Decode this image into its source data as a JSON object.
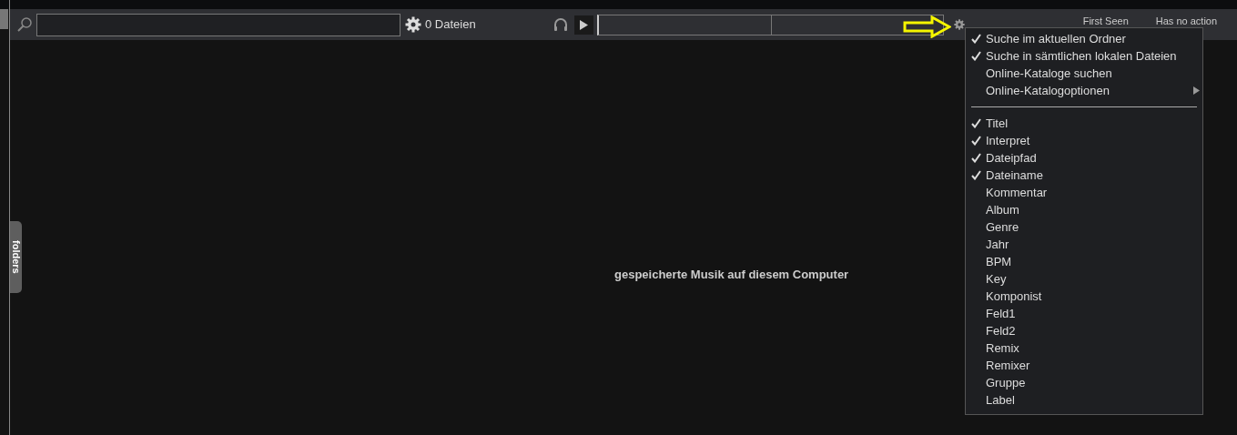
{
  "toolbar": {
    "file_count": "0 Dateien",
    "sort_label": "First Seen",
    "action_label": "Has no action"
  },
  "sidebar_tab": {
    "label": "folders"
  },
  "empty_message": "gespeicherte Musik auf diesem Computer",
  "menu": {
    "search_options": [
      {
        "label": "Suche im aktuellen Ordner",
        "checked": true,
        "has_submenu": false
      },
      {
        "label": "Suche in sämtlichen lokalen Dateien",
        "checked": true,
        "has_submenu": false
      },
      {
        "label": "Online-Kataloge suchen",
        "checked": false,
        "has_submenu": false
      },
      {
        "label": "Online-Katalogoptionen",
        "checked": false,
        "has_submenu": true
      }
    ],
    "fields": [
      {
        "label": "Titel",
        "checked": true
      },
      {
        "label": "Interpret",
        "checked": true
      },
      {
        "label": "Dateipfad",
        "checked": true
      },
      {
        "label": "Dateiname",
        "checked": true
      },
      {
        "label": "Kommentar",
        "checked": false
      },
      {
        "label": "Album",
        "checked": false
      },
      {
        "label": "Genre",
        "checked": false
      },
      {
        "label": "Jahr",
        "checked": false
      },
      {
        "label": "BPM",
        "checked": false
      },
      {
        "label": "Key",
        "checked": false
      },
      {
        "label": "Komponist",
        "checked": false
      },
      {
        "label": "Feld1",
        "checked": false
      },
      {
        "label": "Feld2",
        "checked": false
      },
      {
        "label": "Remix",
        "checked": false
      },
      {
        "label": "Remixer",
        "checked": false
      },
      {
        "label": "Gruppe",
        "checked": false
      },
      {
        "label": "Label",
        "checked": false
      }
    ]
  }
}
